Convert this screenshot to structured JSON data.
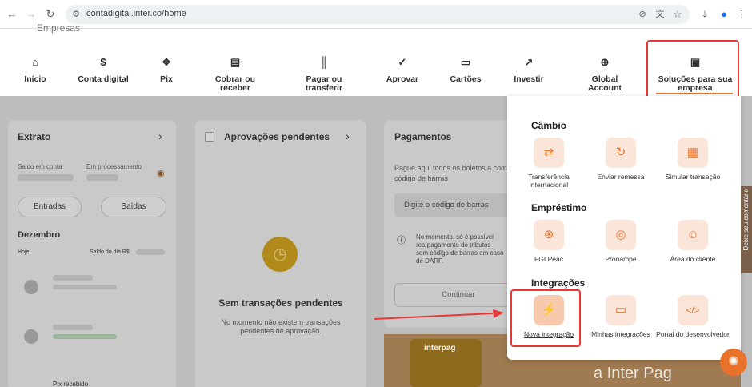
{
  "browser": {
    "url": "contadigital.inter.co/home",
    "icons": [
      "back-icon",
      "forward-icon",
      "reload-icon",
      "site-info-icon",
      "eye-off-icon",
      "translate-icon",
      "star-icon",
      "download-icon",
      "profile-icon",
      "menu-icon"
    ]
  },
  "header": {
    "logo_text": "Empresas",
    "nav": [
      {
        "label": "Início",
        "icon": "home-icon"
      },
      {
        "label": "Conta digital",
        "icon": "dollar-icon"
      },
      {
        "label": "Pix",
        "icon": "pix-icon"
      },
      {
        "label": "Cobrar ou receber",
        "icon": "invoice-icon"
      },
      {
        "label": "Pagar ou transferir",
        "icon": "barcode-icon"
      },
      {
        "label": "Aprovar",
        "icon": "approve-icon"
      },
      {
        "label": "Cartões",
        "icon": "card-icon"
      },
      {
        "label": "Investir",
        "icon": "trend-icon"
      },
      {
        "label": "Global Account",
        "icon": "globe-icon"
      },
      {
        "label": "Soluções para sua empresa",
        "icon": "store-icon"
      }
    ]
  },
  "extrato": {
    "title": "Extrato",
    "saldo_label": "Saldo em conta",
    "processamento_label": "Em processamento",
    "entradas": "Entradas",
    "saidas": "Saídas",
    "month": "Dezembro",
    "hoje": "Hoje",
    "saldo_do_dia": "Saldo do dia R$",
    "pix_recebido": "Pix recebido"
  },
  "aprovacoes": {
    "title": "Aprovações pendentes",
    "empty_title": "Sem transações pendentes",
    "empty_desc": "No momento não existem transações pendentes de aprovação."
  },
  "pagamentos": {
    "title": "Pagamentos",
    "desc": "Pague aqui todos os boletos a com código de barras",
    "input_placeholder": "Digite o código de barras",
    "notice": "No momento, só é possível rea pagamento de tributos sem código de barras em caso de DARF.",
    "continue": "Continuar",
    "promo": "a Inter Pag",
    "promo_brand": "interpag"
  },
  "dropdown": {
    "cambio": "Câmbio",
    "cambio_items": [
      {
        "label": "Transferência internacional",
        "icon": "exchange-icon"
      },
      {
        "label": "Enviar remessa",
        "icon": "remittance-icon"
      },
      {
        "label": "Simular transação",
        "icon": "calculator-icon"
      }
    ],
    "emprestimo": "Empréstimo",
    "emprestimo_items": [
      {
        "label": "FGI Peac",
        "icon": "loan-icon"
      },
      {
        "label": "Pronampe",
        "icon": "loan-dollar-icon"
      },
      {
        "label": "Área do cliente",
        "icon": "user-icon"
      }
    ],
    "integracoes": "Integrações",
    "integracoes_items": [
      {
        "label": "Nova integração",
        "icon": "plug-icon"
      },
      {
        "label": "Minhas integrações",
        "icon": "monitor-icon"
      },
      {
        "label": "Portal do desenvolvedor",
        "icon": "code-icon"
      }
    ]
  },
  "feedback": "Deixe seu comentário"
}
